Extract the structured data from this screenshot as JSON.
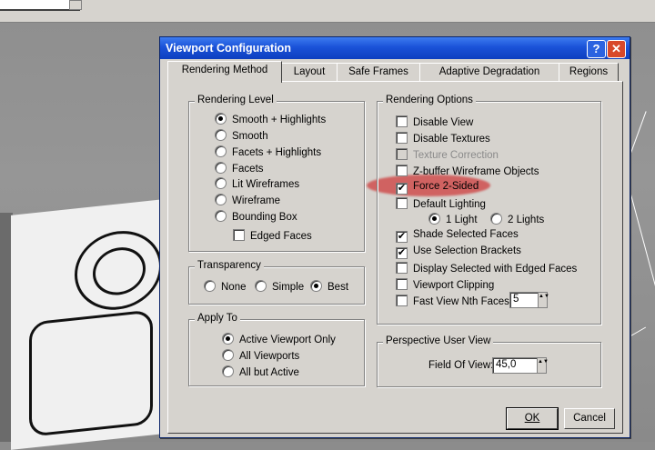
{
  "dialog": {
    "title": "Viewport Configuration",
    "help_glyph": "?",
    "close_glyph": "✕"
  },
  "tabs": [
    {
      "label": "Rendering Method",
      "active": true
    },
    {
      "label": "Layout"
    },
    {
      "label": "Safe Frames"
    },
    {
      "label": "Adaptive Degradation"
    },
    {
      "label": "Regions"
    }
  ],
  "rendering_level": {
    "title": "Rendering Level",
    "options": [
      {
        "label": "Smooth + Highlights",
        "selected": true
      },
      {
        "label": "Smooth"
      },
      {
        "label": "Facets + Highlights"
      },
      {
        "label": "Facets"
      },
      {
        "label": "Lit Wireframes"
      },
      {
        "label": "Wireframe"
      },
      {
        "label": "Bounding Box"
      }
    ],
    "edged_faces": "Edged Faces"
  },
  "transparency": {
    "title": "Transparency",
    "options": [
      {
        "label": "None"
      },
      {
        "label": "Simple"
      },
      {
        "label": "Best",
        "selected": true
      }
    ]
  },
  "apply_to": {
    "title": "Apply To",
    "options": [
      {
        "label": "Active Viewport Only",
        "selected": true
      },
      {
        "label": "All Viewports"
      },
      {
        "label": "All but Active"
      }
    ]
  },
  "rendering_options": {
    "title": "Rendering Options",
    "disable_view": "Disable View",
    "disable_textures": "Disable Textures",
    "texture_correction": "Texture Correction",
    "zbuffer_wireframe": "Z-buffer Wireframe Objects",
    "force_2_sided": "Force 2-Sided",
    "default_lighting": "Default Lighting",
    "one_light": "1 Light",
    "two_lights": "2 Lights",
    "shade_selected": "Shade Selected Faces",
    "use_selection_brackets": "Use Selection Brackets",
    "display_selected_edged": "Display Selected with Edged Faces",
    "viewport_clipping": "Viewport Clipping",
    "fast_view": "Fast View Nth Faces:",
    "fast_view_value": "5"
  },
  "perspective": {
    "title": "Perspective User View",
    "fov_label": "Field Of View:",
    "fov_value": "45,0"
  },
  "buttons": {
    "ok_label": "OK",
    "cancel_label": "Cancel"
  },
  "check_mark": "✔",
  "spin_arrows": "▲▼",
  "colors": {
    "titlebar": "#1a52d8",
    "highlight": "#cd3c3c",
    "face": "#d6d3ce"
  }
}
